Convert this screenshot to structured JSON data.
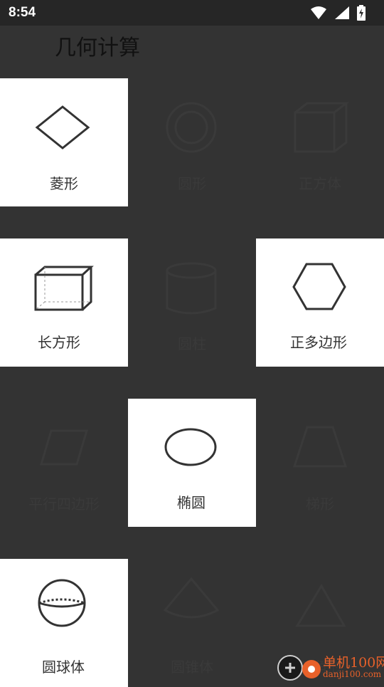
{
  "status_bar": {
    "time": "8:54",
    "icons": [
      "wifi-icon",
      "signal-icon",
      "battery-charging-icon"
    ]
  },
  "header": {
    "title": "几何计算"
  },
  "tiles": [
    {
      "label": "菱形",
      "icon": "rhombus-icon",
      "state": "revealed"
    },
    {
      "label": "圆形",
      "icon": "circle-icon",
      "state": "hidden"
    },
    {
      "label": "正方体",
      "icon": "cube-icon",
      "state": "hidden"
    },
    {
      "label": "长方形",
      "icon": "cuboid-icon",
      "state": "revealed"
    },
    {
      "label": "圆柱",
      "icon": "cylinder-icon",
      "state": "hidden"
    },
    {
      "label": "正多边形",
      "icon": "hexagon-icon",
      "state": "revealed"
    },
    {
      "label": "平行四边形",
      "icon": "parallelogram-icon",
      "state": "hidden"
    },
    {
      "label": "椭圆",
      "icon": "ellipse-icon",
      "state": "revealed"
    },
    {
      "label": "梯形",
      "icon": "trapezoid-icon",
      "state": "hidden"
    },
    {
      "label": "圆球体",
      "icon": "sphere-icon",
      "state": "revealed"
    },
    {
      "label": "圆锥体",
      "icon": "cone-icon",
      "state": "hidden"
    },
    {
      "label": "三角形",
      "icon": "triangle-icon",
      "state": "hidden"
    }
  ],
  "watermark": {
    "name": "单机100网",
    "url": "danji100.com",
    "accent": "#e8612a"
  },
  "colors": {
    "background": "#333333",
    "tile_active": "#ffffff",
    "status_bar": "#262626"
  }
}
